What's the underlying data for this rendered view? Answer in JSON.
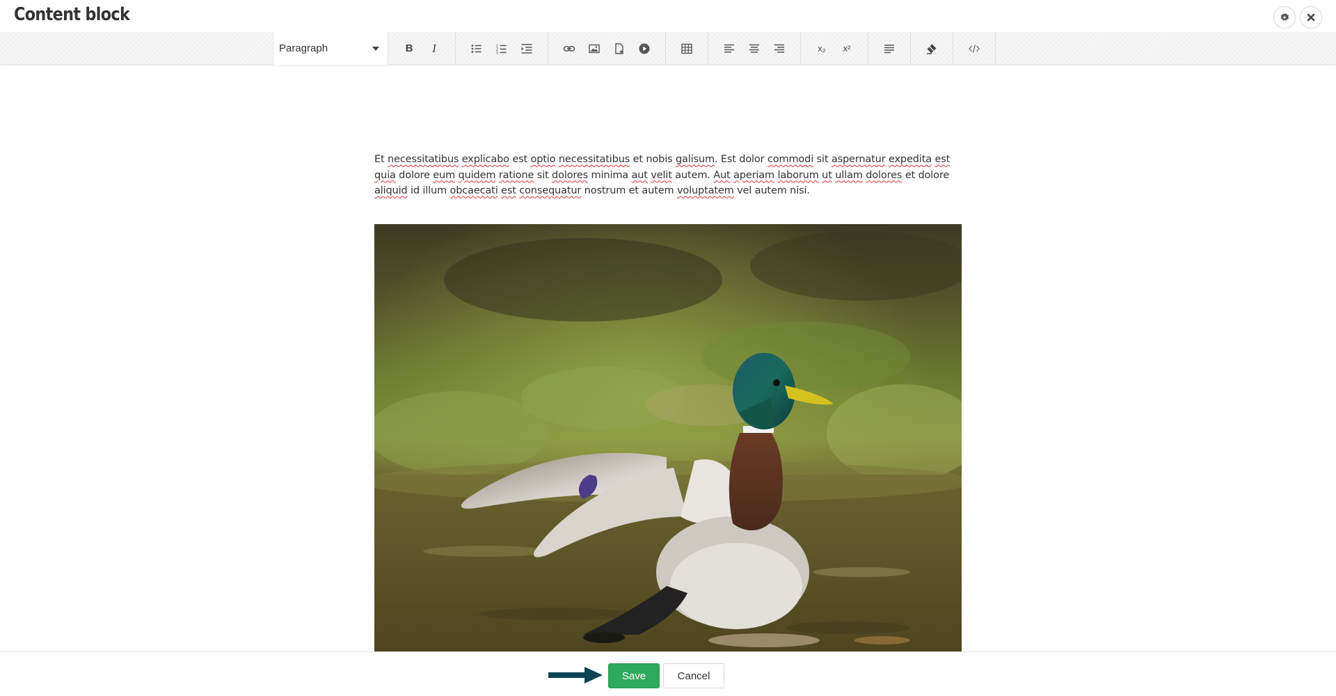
{
  "window": {
    "title": "Content block",
    "settings_icon": "gear-icon",
    "close_icon": "close-icon"
  },
  "toolbar": {
    "format_select": {
      "selected": "Paragraph"
    },
    "buttons": {
      "bold": "B",
      "italic": "I",
      "bullet_list": "bulleted-list-icon",
      "numbered_list": "numbered-list-icon",
      "indent": "indent-icon",
      "link": "link-icon",
      "image": "image-icon",
      "file": "file-icon",
      "media": "play-icon",
      "table": "table-icon",
      "align_left": "align-left-icon",
      "align_center": "align-center-icon",
      "align_right": "align-right-icon",
      "subscript": "x₂",
      "superscript": "x²",
      "paragraph_format": "paragraph-format-icon",
      "clear_formatting": "clear-formatting-icon",
      "source_code": "code-icon"
    }
  },
  "editor": {
    "paragraph": [
      {
        "text": "Et ",
        "misspelled": false
      },
      {
        "text": "necessitatibus",
        "misspelled": true
      },
      {
        "text": " ",
        "misspelled": false
      },
      {
        "text": "explicabo",
        "misspelled": true
      },
      {
        "text": " est ",
        "misspelled": false
      },
      {
        "text": "optio",
        "misspelled": true
      },
      {
        "text": " ",
        "misspelled": false
      },
      {
        "text": "necessitatibus",
        "misspelled": true
      },
      {
        "text": " et nobis ",
        "misspelled": false
      },
      {
        "text": "galisum",
        "misspelled": true
      },
      {
        "text": ". Est dolor ",
        "misspelled": false
      },
      {
        "text": "commodi",
        "misspelled": true
      },
      {
        "text": " sit ",
        "misspelled": false
      },
      {
        "text": "aspernatur",
        "misspelled": true
      },
      {
        "text": " ",
        "misspelled": false
      },
      {
        "text": "expedita",
        "misspelled": true
      },
      {
        "text": " ",
        "misspelled": false
      },
      {
        "text": "est",
        "misspelled": true
      },
      {
        "text": " ",
        "misspelled": false
      },
      {
        "text": "quia",
        "misspelled": true
      },
      {
        "text": " dolore ",
        "misspelled": false
      },
      {
        "text": "eum",
        "misspelled": true
      },
      {
        "text": " ",
        "misspelled": false
      },
      {
        "text": "quidem",
        "misspelled": true
      },
      {
        "text": " ",
        "misspelled": false
      },
      {
        "text": "ratione",
        "misspelled": true
      },
      {
        "text": " sit ",
        "misspelled": false
      },
      {
        "text": "dolores",
        "misspelled": true
      },
      {
        "text": " minima ",
        "misspelled": false
      },
      {
        "text": "aut",
        "misspelled": true
      },
      {
        "text": " ",
        "misspelled": false
      },
      {
        "text": "velit",
        "misspelled": true
      },
      {
        "text": " autem. ",
        "misspelled": false
      },
      {
        "text": "Aut",
        "misspelled": true
      },
      {
        "text": " ",
        "misspelled": false
      },
      {
        "text": "aperiam",
        "misspelled": true
      },
      {
        "text": " ",
        "misspelled": false
      },
      {
        "text": "laborum",
        "misspelled": true
      },
      {
        "text": " ",
        "misspelled": false
      },
      {
        "text": "ut",
        "misspelled": true
      },
      {
        "text": " ",
        "misspelled": false
      },
      {
        "text": "ullam",
        "misspelled": true
      },
      {
        "text": " ",
        "misspelled": false
      },
      {
        "text": "dolores",
        "misspelled": true
      },
      {
        "text": " et dolore ",
        "misspelled": false
      },
      {
        "text": "aliquid",
        "misspelled": true
      },
      {
        "text": " id illum ",
        "misspelled": false
      },
      {
        "text": "obcaecati",
        "misspelled": true
      },
      {
        "text": " ",
        "misspelled": false
      },
      {
        "text": "est",
        "misspelled": true
      },
      {
        "text": " ",
        "misspelled": false
      },
      {
        "text": "consequatur",
        "misspelled": true
      },
      {
        "text": " nostrum et autem ",
        "misspelled": false
      },
      {
        "text": "voluptatem",
        "misspelled": true
      },
      {
        "text": " vel autem nisi.",
        "misspelled": false
      }
    ],
    "image": "mallard-duck-photo"
  },
  "footer": {
    "pointer": "arrow-right-icon",
    "save_label": "Save",
    "cancel_label": "Cancel"
  },
  "colors": {
    "save_button": "#2eaa5c",
    "arrow": "#0d4455",
    "spellcheck_underline": "#dd3333"
  }
}
